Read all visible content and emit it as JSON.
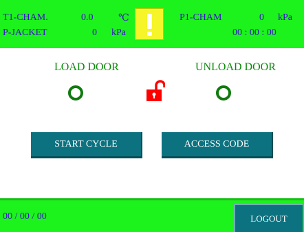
{
  "header": {
    "t1_label": "T1-CHAM.",
    "t1_value": "0.0",
    "t1_unit": "℃",
    "p1_label": "P1-CHAM",
    "p1_value": "0",
    "p1_unit": "kPa",
    "pj_label": "P-JACKET",
    "pj_value": "0",
    "pj_unit": "kPa",
    "timer": "00 : 00 : 00",
    "warning_icon": "exclamation-icon"
  },
  "doors": {
    "load_label": "LOAD DOOR",
    "unload_label": "UNLOAD DOOR",
    "lock_icon": "unlocked-padlock-icon",
    "lock_color": "#ff0000",
    "indicator_color": "#0f7a0f"
  },
  "buttons": {
    "start_cycle": "START CYCLE",
    "access_code": "ACCESS CODE"
  },
  "footer": {
    "date": "00 / 00 / 00",
    "logout": "LOGOUT"
  },
  "colors": {
    "panel_green": "#1cf21c",
    "button_teal": "#0c7280",
    "text_blue": "#3a10c8",
    "warning_yellow": "#f5f52a"
  }
}
